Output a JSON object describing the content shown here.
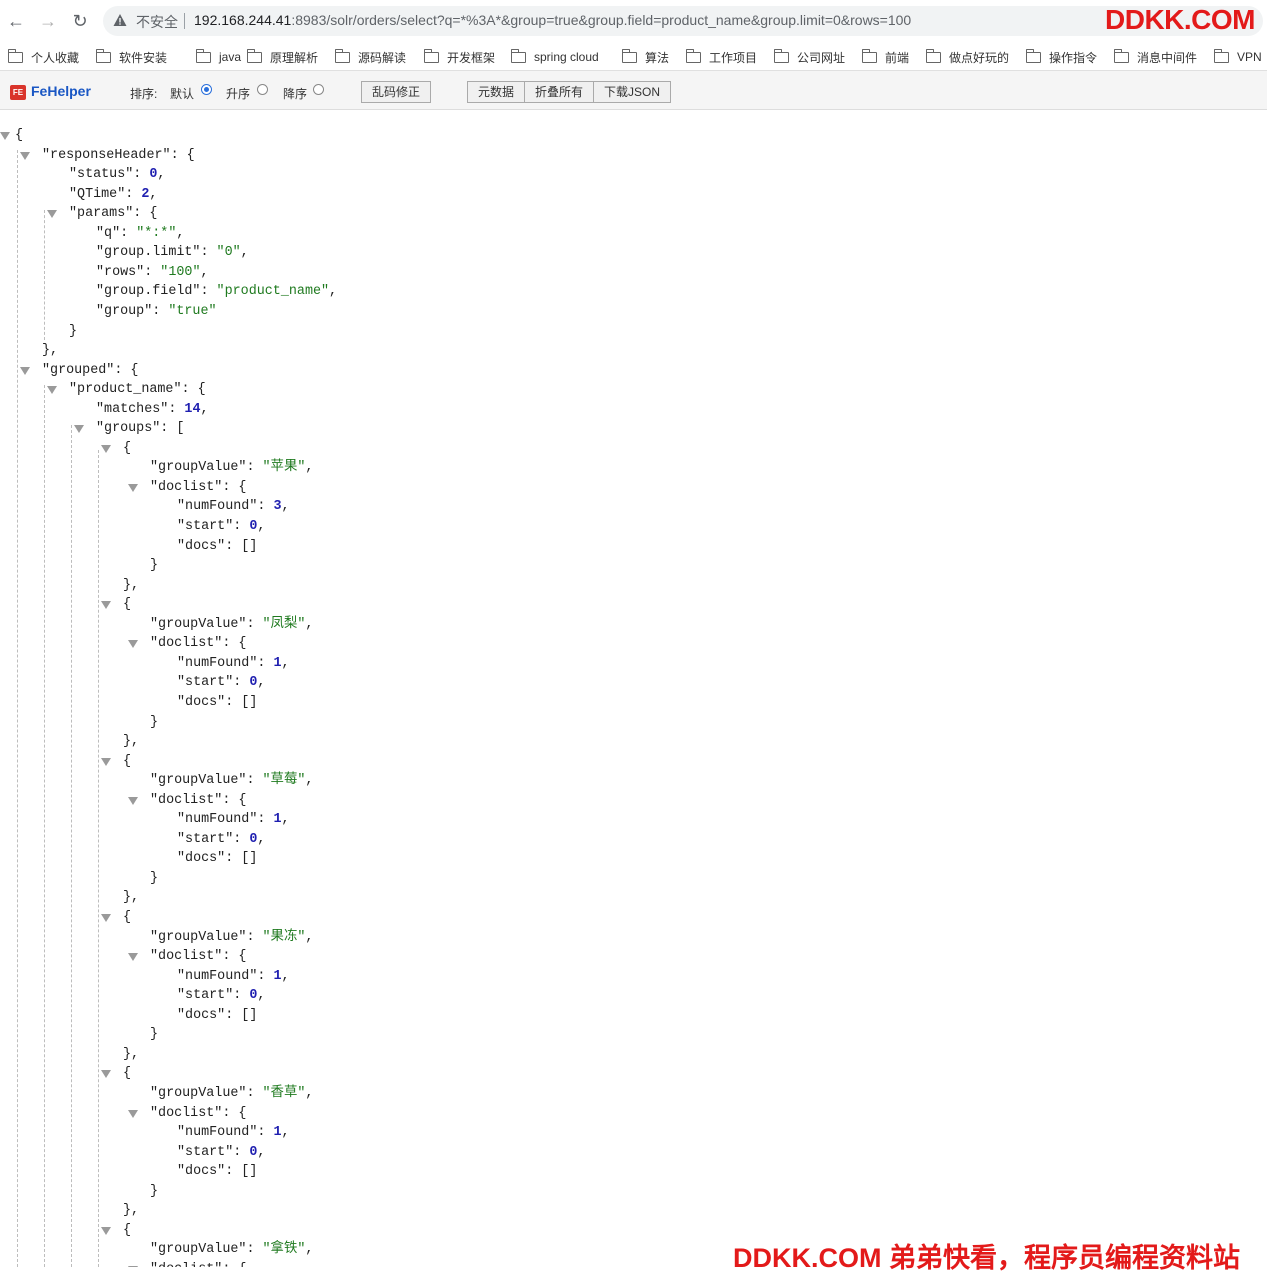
{
  "browser": {
    "insecure_label": "不安全",
    "url_host": "192.168.244.41",
    "url_rest": ":8983/solr/orders/select?q=*%3A*&group=true&group.field=product_name&group.limit=0&rows=100",
    "watermark_top": "DDKK.COM"
  },
  "bookmarks": [
    "个人收藏",
    "软件安装",
    "java",
    "原理解析",
    "源码解读",
    "开发框架",
    "spring cloud",
    "算法",
    "工作项目",
    "公司网址",
    "前端",
    "做点好玩的",
    "操作指令",
    "消息中间件",
    "VPN"
  ],
  "fehelper": {
    "logo": "FE",
    "name": "FeHelper",
    "sort_label": "排序:",
    "sort_options": [
      "默认",
      "升序",
      "降序"
    ],
    "sort_selected": "默认",
    "fix_encoding": "乱码修正",
    "metadata": "元数据",
    "collapse_all": "折叠所有",
    "download_json": "下载JSON"
  },
  "json_lines": [
    [
      {
        "t": "p",
        "v": "{"
      }
    ],
    [
      {
        "t": "k",
        "v": "\"responseHeader\""
      },
      {
        "t": "p",
        "v": ": {"
      }
    ],
    [
      {
        "t": "k",
        "v": "\"status\""
      },
      {
        "t": "p",
        "v": ": "
      },
      {
        "t": "n",
        "v": "0"
      },
      {
        "t": "p",
        "v": ","
      }
    ],
    [
      {
        "t": "k",
        "v": "\"QTime\""
      },
      {
        "t": "p",
        "v": ": "
      },
      {
        "t": "n",
        "v": "2"
      },
      {
        "t": "p",
        "v": ","
      }
    ],
    [
      {
        "t": "k",
        "v": "\"params\""
      },
      {
        "t": "p",
        "v": ": {"
      }
    ],
    [
      {
        "t": "k",
        "v": "\"q\""
      },
      {
        "t": "p",
        "v": ": "
      },
      {
        "t": "s",
        "v": "\"*:*\""
      },
      {
        "t": "p",
        "v": ","
      }
    ],
    [
      {
        "t": "k",
        "v": "\"group.limit\""
      },
      {
        "t": "p",
        "v": ": "
      },
      {
        "t": "s",
        "v": "\"0\""
      },
      {
        "t": "p",
        "v": ","
      }
    ],
    [
      {
        "t": "k",
        "v": "\"rows\""
      },
      {
        "t": "p",
        "v": ": "
      },
      {
        "t": "s",
        "v": "\"100\""
      },
      {
        "t": "p",
        "v": ","
      }
    ],
    [
      {
        "t": "k",
        "v": "\"group.field\""
      },
      {
        "t": "p",
        "v": ": "
      },
      {
        "t": "s",
        "v": "\"product_name\""
      },
      {
        "t": "p",
        "v": ","
      }
    ],
    [
      {
        "t": "k",
        "v": "\"group\""
      },
      {
        "t": "p",
        "v": ": "
      },
      {
        "t": "s",
        "v": "\"true\""
      }
    ],
    [
      {
        "t": "p",
        "v": "}"
      }
    ],
    [
      {
        "t": "p",
        "v": "},"
      }
    ],
    [
      {
        "t": "k",
        "v": "\"grouped\""
      },
      {
        "t": "p",
        "v": ": {"
      }
    ],
    [
      {
        "t": "k",
        "v": "\"product_name\""
      },
      {
        "t": "p",
        "v": ": {"
      }
    ],
    [
      {
        "t": "k",
        "v": "\"matches\""
      },
      {
        "t": "p",
        "v": ": "
      },
      {
        "t": "n",
        "v": "14"
      },
      {
        "t": "p",
        "v": ","
      }
    ],
    [
      {
        "t": "k",
        "v": "\"groups\""
      },
      {
        "t": "p",
        "v": ": ["
      }
    ],
    [
      {
        "t": "p",
        "v": "{"
      }
    ],
    [
      {
        "t": "k",
        "v": "\"groupValue\""
      },
      {
        "t": "p",
        "v": ": "
      },
      {
        "t": "s",
        "v": "\"苹果\""
      },
      {
        "t": "p",
        "v": ","
      }
    ],
    [
      {
        "t": "k",
        "v": "\"doclist\""
      },
      {
        "t": "p",
        "v": ": {"
      }
    ],
    [
      {
        "t": "k",
        "v": "\"numFound\""
      },
      {
        "t": "p",
        "v": ": "
      },
      {
        "t": "n",
        "v": "3"
      },
      {
        "t": "p",
        "v": ","
      }
    ],
    [
      {
        "t": "k",
        "v": "\"start\""
      },
      {
        "t": "p",
        "v": ": "
      },
      {
        "t": "n",
        "v": "0"
      },
      {
        "t": "p",
        "v": ","
      }
    ],
    [
      {
        "t": "k",
        "v": "\"docs\""
      },
      {
        "t": "p",
        "v": ": []"
      }
    ],
    [
      {
        "t": "p",
        "v": "}"
      }
    ],
    [
      {
        "t": "p",
        "v": "},"
      }
    ],
    [
      {
        "t": "p",
        "v": "{"
      }
    ],
    [
      {
        "t": "k",
        "v": "\"groupValue\""
      },
      {
        "t": "p",
        "v": ": "
      },
      {
        "t": "s",
        "v": "\"凤梨\""
      },
      {
        "t": "p",
        "v": ","
      }
    ],
    [
      {
        "t": "k",
        "v": "\"doclist\""
      },
      {
        "t": "p",
        "v": ": {"
      }
    ],
    [
      {
        "t": "k",
        "v": "\"numFound\""
      },
      {
        "t": "p",
        "v": ": "
      },
      {
        "t": "n",
        "v": "1"
      },
      {
        "t": "p",
        "v": ","
      }
    ],
    [
      {
        "t": "k",
        "v": "\"start\""
      },
      {
        "t": "p",
        "v": ": "
      },
      {
        "t": "n",
        "v": "0"
      },
      {
        "t": "p",
        "v": ","
      }
    ],
    [
      {
        "t": "k",
        "v": "\"docs\""
      },
      {
        "t": "p",
        "v": ": []"
      }
    ],
    [
      {
        "t": "p",
        "v": "}"
      }
    ],
    [
      {
        "t": "p",
        "v": "},"
      }
    ],
    [
      {
        "t": "p",
        "v": "{"
      }
    ],
    [
      {
        "t": "k",
        "v": "\"groupValue\""
      },
      {
        "t": "p",
        "v": ": "
      },
      {
        "t": "s",
        "v": "\"草莓\""
      },
      {
        "t": "p",
        "v": ","
      }
    ],
    [
      {
        "t": "k",
        "v": "\"doclist\""
      },
      {
        "t": "p",
        "v": ": {"
      }
    ],
    [
      {
        "t": "k",
        "v": "\"numFound\""
      },
      {
        "t": "p",
        "v": ": "
      },
      {
        "t": "n",
        "v": "1"
      },
      {
        "t": "p",
        "v": ","
      }
    ],
    [
      {
        "t": "k",
        "v": "\"start\""
      },
      {
        "t": "p",
        "v": ": "
      },
      {
        "t": "n",
        "v": "0"
      },
      {
        "t": "p",
        "v": ","
      }
    ],
    [
      {
        "t": "k",
        "v": "\"docs\""
      },
      {
        "t": "p",
        "v": ": []"
      }
    ],
    [
      {
        "t": "p",
        "v": "}"
      }
    ],
    [
      {
        "t": "p",
        "v": "},"
      }
    ],
    [
      {
        "t": "p",
        "v": "{"
      }
    ],
    [
      {
        "t": "k",
        "v": "\"groupValue\""
      },
      {
        "t": "p",
        "v": ": "
      },
      {
        "t": "s",
        "v": "\"果冻\""
      },
      {
        "t": "p",
        "v": ","
      }
    ],
    [
      {
        "t": "k",
        "v": "\"doclist\""
      },
      {
        "t": "p",
        "v": ": {"
      }
    ],
    [
      {
        "t": "k",
        "v": "\"numFound\""
      },
      {
        "t": "p",
        "v": ": "
      },
      {
        "t": "n",
        "v": "1"
      },
      {
        "t": "p",
        "v": ","
      }
    ],
    [
      {
        "t": "k",
        "v": "\"start\""
      },
      {
        "t": "p",
        "v": ": "
      },
      {
        "t": "n",
        "v": "0"
      },
      {
        "t": "p",
        "v": ","
      }
    ],
    [
      {
        "t": "k",
        "v": "\"docs\""
      },
      {
        "t": "p",
        "v": ": []"
      }
    ],
    [
      {
        "t": "p",
        "v": "}"
      }
    ],
    [
      {
        "t": "p",
        "v": "},"
      }
    ],
    [
      {
        "t": "p",
        "v": "{"
      }
    ],
    [
      {
        "t": "k",
        "v": "\"groupValue\""
      },
      {
        "t": "p",
        "v": ": "
      },
      {
        "t": "s",
        "v": "\"香草\""
      },
      {
        "t": "p",
        "v": ","
      }
    ],
    [
      {
        "t": "k",
        "v": "\"doclist\""
      },
      {
        "t": "p",
        "v": ": {"
      }
    ],
    [
      {
        "t": "k",
        "v": "\"numFound\""
      },
      {
        "t": "p",
        "v": ": "
      },
      {
        "t": "n",
        "v": "1"
      },
      {
        "t": "p",
        "v": ","
      }
    ],
    [
      {
        "t": "k",
        "v": "\"start\""
      },
      {
        "t": "p",
        "v": ": "
      },
      {
        "t": "n",
        "v": "0"
      },
      {
        "t": "p",
        "v": ","
      }
    ],
    [
      {
        "t": "k",
        "v": "\"docs\""
      },
      {
        "t": "p",
        "v": ": []"
      }
    ],
    [
      {
        "t": "p",
        "v": "}"
      }
    ],
    [
      {
        "t": "p",
        "v": "},"
      }
    ],
    [
      {
        "t": "p",
        "v": "{"
      }
    ],
    [
      {
        "t": "k",
        "v": "\"groupValue\""
      },
      {
        "t": "p",
        "v": ": "
      },
      {
        "t": "s",
        "v": "\"拿铁\""
      },
      {
        "t": "p",
        "v": ","
      }
    ],
    [
      {
        "t": "k",
        "v": "\"doclist\""
      },
      {
        "t": "p",
        "v": ": {"
      }
    ]
  ],
  "watermark_bottom": "DDKK.COM 弟弟快看，程序员编程资料站",
  "colors": {
    "key": "#222222",
    "number": "#1f1fb0",
    "string": "#1f7a1f",
    "watermark": "#e31a1a",
    "fehelper_brand": "#1a57c4"
  }
}
